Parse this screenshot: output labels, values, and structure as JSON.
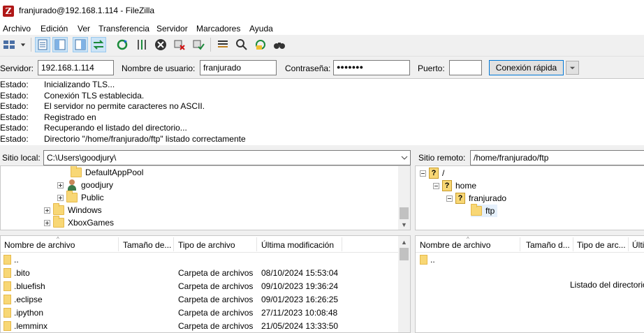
{
  "window": {
    "title": "franjurado@192.168.1.114 - FileZilla",
    "app_icon_letter": "Z"
  },
  "menu": [
    "Archivo",
    "Edición",
    "Ver",
    "Transferencia",
    "Servidor",
    "Marcadores",
    "Ayuda"
  ],
  "toolbar": {
    "icons": [
      "site-manager-icon",
      "dropdown-arrow-icon",
      "toggle-log-icon",
      "toggle-local-tree-icon",
      "toggle-remote-tree-icon",
      "toggle-queue-icon",
      "refresh-icon",
      "process-queue-icon",
      "cancel-icon",
      "disconnect-icon",
      "reconnect-icon",
      "filter-icon",
      "compare-icon",
      "sync-browse-icon",
      "search-icon"
    ]
  },
  "quickconnect": {
    "server_label": "Servidor:",
    "server_value": "192.168.1.114",
    "user_label": "Nombre de usuario:",
    "user_value": "franjurado",
    "password_label": "Contraseña:",
    "password_value": "●●●●●●●",
    "port_label": "Puerto:",
    "port_value": "",
    "connect_label": "Conexión rápida"
  },
  "log": [
    {
      "key": "Estado:",
      "value": "Inicializando TLS..."
    },
    {
      "key": "Estado:",
      "value": "Conexión TLS establecida."
    },
    {
      "key": "Estado:",
      "value": "El servidor no permite caracteres no ASCII."
    },
    {
      "key": "Estado:",
      "value": "Registrado en"
    },
    {
      "key": "Estado:",
      "value": "Recuperando el listado del directorio..."
    },
    {
      "key": "Estado:",
      "value": "Directorio \"/home/franjurado/ftp\" listado correctamente"
    }
  ],
  "local": {
    "site_label": "Sitio local:",
    "path": "C:\\Users\\goodjury\\",
    "tree": [
      {
        "label": "DefaultAppPool",
        "expander": "none",
        "icon": "folder"
      },
      {
        "label": "goodjury",
        "expander": "plus",
        "icon": "user"
      },
      {
        "label": "Public",
        "expander": "plus",
        "icon": "folder"
      },
      {
        "label": "Windows",
        "expander": "plus",
        "icon": "folder"
      },
      {
        "label": "XboxGames",
        "expander": "plus",
        "icon": "folder"
      }
    ],
    "columns": [
      "Nombre de archivo",
      "Tamaño de...",
      "Tipo de archivo",
      "Última modificación"
    ],
    "files": [
      {
        "name": "..",
        "size": "",
        "type": "",
        "modified": ""
      },
      {
        "name": ".bito",
        "size": "",
        "type": "Carpeta de archivos",
        "modified": "08/10/2024 15:53:04"
      },
      {
        "name": ".bluefish",
        "size": "",
        "type": "Carpeta de archivos",
        "modified": "09/10/2023 19:36:24"
      },
      {
        "name": ".eclipse",
        "size": "",
        "type": "Carpeta de archivos",
        "modified": "09/01/2023 16:26:25"
      },
      {
        "name": ".ipython",
        "size": "",
        "type": "Carpeta de archivos",
        "modified": "27/11/2023 10:08:48"
      },
      {
        "name": ".lemminx",
        "size": "",
        "type": "Carpeta de archivos",
        "modified": "21/05/2024 13:33:50"
      }
    ]
  },
  "remote": {
    "site_label": "Sitio remoto:",
    "path": "/home/franjurado/ftp",
    "tree": [
      {
        "label": "/",
        "expander": "minus",
        "icon": "question-folder"
      },
      {
        "label": "home",
        "expander": "minus",
        "icon": "question-folder"
      },
      {
        "label": "franjurado",
        "expander": "minus",
        "icon": "question-folder"
      },
      {
        "label": "ftp",
        "expander": "none",
        "icon": "folder"
      }
    ],
    "columns": [
      "Nombre de archivo",
      "Tamaño d...",
      "Tipo de arc...",
      "Últi"
    ],
    "files": [
      {
        "name": ".."
      }
    ],
    "status_text": "Listado del directorio"
  }
}
